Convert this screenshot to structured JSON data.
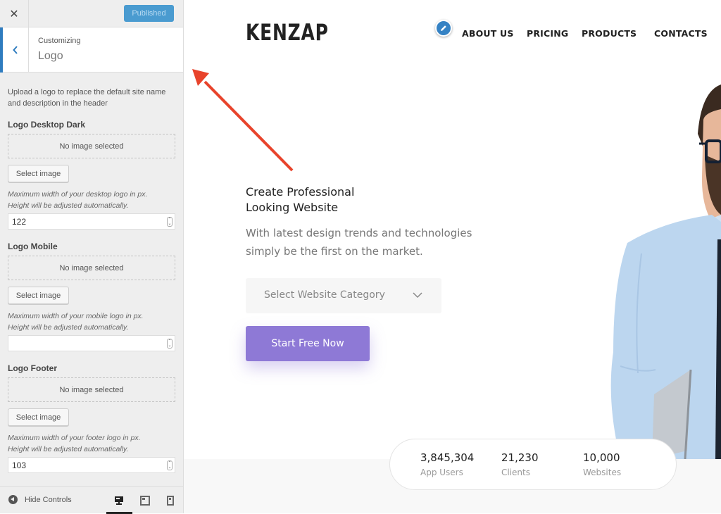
{
  "customizer": {
    "close_icon": "close-x",
    "publish_label": "Published",
    "back_icon": "chevron-left",
    "customizing_label": "Customizing",
    "section_title": "Logo",
    "description": "Upload a logo to replace the default site name and description in the header",
    "controls": [
      {
        "title": "Logo Desktop Dark",
        "placeholder": "No image selected",
        "button_label": "Select image",
        "note_line1": "Maximum width of your desktop logo in px.",
        "note_line2": "Height will be adjusted automatically.",
        "value": "122"
      },
      {
        "title": "Logo Mobile",
        "placeholder": "No image selected",
        "button_label": "Select image",
        "note_line1": "Maximum width of your mobile logo in px.",
        "note_line2": "Height will be adjusted automatically.",
        "value": ""
      },
      {
        "title": "Logo Footer",
        "placeholder": "No image selected",
        "button_label": "Select image",
        "note_line1": "Maximum width of your footer logo in px.",
        "note_line2": "Height will be adjusted automatically.",
        "value": "103"
      }
    ],
    "footer": {
      "hide_controls_label": "Hide Controls",
      "devices": [
        "desktop",
        "tablet",
        "mobile"
      ],
      "active_device": "desktop"
    }
  },
  "preview": {
    "logo_text": "KENZAP",
    "nav": [
      "ABOUT US",
      "PRICING",
      "PRODUCTS",
      "CONTACTS"
    ],
    "hero": {
      "title_line1": "Create Professional",
      "title_line2": "Looking Website",
      "subtitle_line1": "With latest design trends and technologies",
      "subtitle_line2": "simply be the first on the market.",
      "select_placeholder": "Select Website Category",
      "cta_label": "Start Free Now"
    },
    "stats": [
      {
        "value": "3,845,304",
        "label": "App Users"
      },
      {
        "value": "21,230",
        "label": "Clients"
      },
      {
        "value": "10,000",
        "label": "Websites"
      }
    ]
  },
  "colors": {
    "wp_blue": "#2f7cbf",
    "publish_bg": "#4a9bd0",
    "cta_purple": "#8e79d6",
    "annotation_arrow": "#e8432b"
  }
}
